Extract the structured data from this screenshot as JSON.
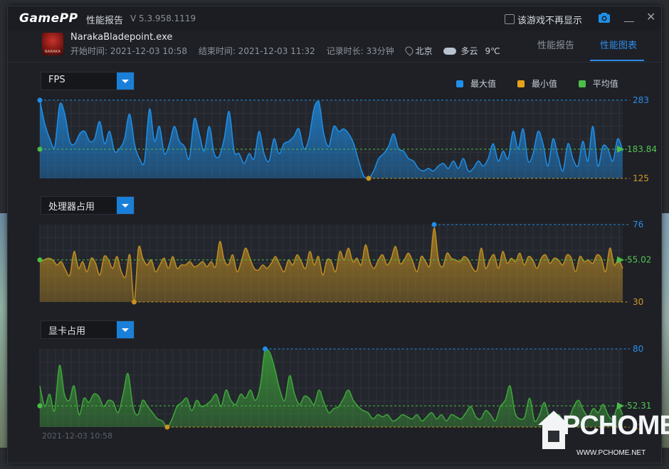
{
  "window": {
    "logo": "GamePP",
    "title": "性能报告",
    "version": "V 5.3.958.1119",
    "checkbox_label": "该游戏不再显示"
  },
  "app": {
    "icon_label": "NARAKA",
    "exe_name": "NarakaBladepoint.exe",
    "start_time": "开始时间: 2021-12-03 10:58",
    "end_time": "结束时间: 2021-12-03 11:32",
    "duration": "记录时长: 33分钟",
    "location": "北京",
    "weather": "多云",
    "temperature": "9℃"
  },
  "tabs": [
    {
      "label": "性能报告",
      "active": false
    },
    {
      "label": "性能图表",
      "active": true
    }
  ],
  "legend": [
    {
      "label": "最大值",
      "color": "#1f8fe8"
    },
    {
      "label": "最小值",
      "color": "#e6a21a"
    },
    {
      "label": "平均值",
      "color": "#4cbd48"
    }
  ],
  "chart_data": [
    {
      "type": "area",
      "selector": "FPS",
      "color": "#1e8fea",
      "max": 283,
      "min": 125,
      "avg": "183.84",
      "ylim": [
        125,
        283
      ],
      "values": [
        283,
        235,
        205,
        190,
        275,
        255,
        200,
        195,
        215,
        220,
        200,
        205,
        240,
        195,
        220,
        180,
        185,
        205,
        255,
        195,
        165,
        160,
        265,
        200,
        230,
        175,
        195,
        230,
        200,
        190,
        165,
        245,
        215,
        180,
        230,
        175,
        170,
        205,
        260,
        180,
        175,
        155,
        175,
        165,
        220,
        175,
        160,
        205,
        175,
        195,
        200,
        210,
        225,
        185,
        205,
        265,
        280,
        215,
        190,
        230,
        220,
        225,
        215,
        195,
        160,
        130,
        125,
        140,
        165,
        175,
        190,
        215,
        185,
        180,
        165,
        160,
        145,
        140,
        145,
        140,
        150,
        155,
        145,
        160,
        145,
        165,
        140,
        145,
        160,
        150,
        165,
        195,
        160,
        180,
        165,
        220,
        185,
        225,
        160,
        175,
        220,
        195,
        150,
        205,
        170,
        140,
        195,
        165,
        150,
        200,
        160,
        230,
        150,
        190,
        185,
        160,
        205,
        180
      ]
    },
    {
      "type": "area",
      "selector": "处理器占用",
      "color": "#c08e22",
      "max": 76,
      "min": 30,
      "avg": "55.02",
      "ylim": [
        30,
        76
      ],
      "values": [
        54,
        55,
        56,
        55,
        52,
        54,
        49,
        46,
        60,
        50,
        54,
        48,
        56,
        53,
        46,
        57,
        55,
        50,
        57,
        48,
        45,
        58,
        30,
        62,
        56,
        52,
        55,
        48,
        52,
        56,
        50,
        57,
        50,
        52,
        52,
        54,
        51,
        52,
        54,
        51,
        54,
        51,
        66,
        55,
        52,
        58,
        48,
        54,
        62,
        56,
        50,
        49,
        52,
        50,
        53,
        57,
        52,
        48,
        55,
        52,
        58,
        54,
        50,
        60,
        52,
        57,
        46,
        55,
        54,
        48,
        60,
        55,
        62,
        54,
        56,
        52,
        64,
        54,
        50,
        55,
        58,
        52,
        56,
        63,
        53,
        55,
        59,
        54,
        48,
        57,
        54,
        52,
        74,
        55,
        51,
        59,
        56,
        55,
        54,
        57,
        55,
        50,
        49,
        62,
        50,
        55,
        58,
        50,
        60,
        53,
        56,
        54,
        59,
        52,
        57,
        55,
        50,
        56,
        58,
        53,
        56,
        55,
        52,
        58,
        56,
        48,
        57,
        54,
        55,
        53,
        58,
        56,
        48,
        62,
        52,
        55,
        50
      ]
    },
    {
      "type": "area",
      "selector": "显卡占用",
      "color": "#3ea83a",
      "max": 80,
      "min": 42,
      "avg": "52.31",
      "ylim": [
        42,
        80
      ],
      "values": [
        62,
        52,
        58,
        50,
        72,
        58,
        55,
        62,
        48,
        56,
        54,
        58,
        57,
        52,
        55,
        54,
        49,
        58,
        68,
        52,
        48,
        55,
        52,
        49,
        46,
        45,
        42,
        46,
        52,
        54,
        56,
        50,
        55,
        52,
        53,
        55,
        58,
        52,
        60,
        55,
        53,
        58,
        56,
        60,
        55,
        62,
        80,
        78,
        70,
        60,
        55,
        67,
        58,
        53,
        57,
        56,
        53,
        60,
        54,
        49,
        51,
        52,
        56,
        60,
        55,
        52,
        50,
        49,
        46,
        48,
        47,
        48,
        45,
        46,
        48,
        47,
        46,
        48,
        45,
        47,
        49,
        46,
        48,
        45,
        48,
        47,
        46,
        49,
        52,
        47,
        46,
        50,
        48,
        45,
        52,
        55,
        62,
        49,
        46,
        47,
        56,
        45,
        48,
        54,
        47,
        46,
        48,
        44,
        46,
        52,
        55,
        50,
        47,
        51,
        49,
        53,
        48,
        46,
        52,
        48
      ]
    }
  ],
  "timestamp": "2021-12-03 10:58",
  "watermark": {
    "text": "PCHOME",
    "url": "WWW.PCHOME.NET"
  }
}
